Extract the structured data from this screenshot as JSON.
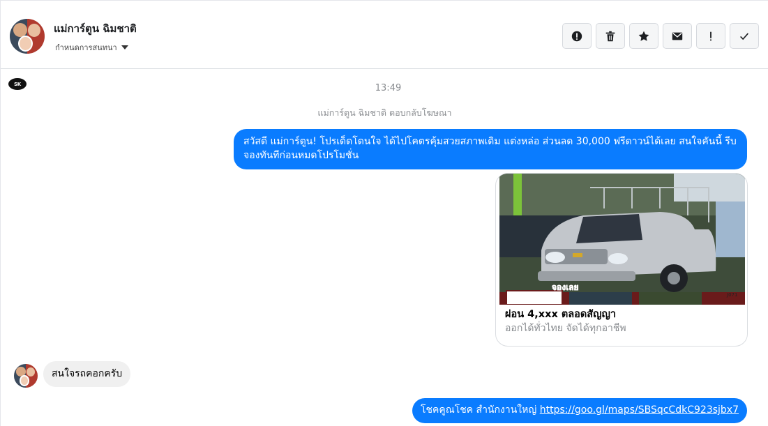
{
  "header": {
    "contact_name": "แม่การ์ตูน ฉิมชาติ",
    "status_label": "กำหนดการสนทนา",
    "toolbar": [
      {
        "name": "report-button",
        "icon": "exclamation-circle-icon"
      },
      {
        "name": "delete-button",
        "icon": "trash-icon"
      },
      {
        "name": "star-button",
        "icon": "star-icon"
      },
      {
        "name": "mark-unread-button",
        "icon": "envelope-icon"
      },
      {
        "name": "priority-button",
        "icon": "exclamation-icon"
      },
      {
        "name": "done-button",
        "icon": "check-icon"
      }
    ]
  },
  "thread": {
    "page_logo": "SK",
    "timestamp": "13:49",
    "notice": "แม่การ์ตูน ฉิมชาติ ตอบกลับโฆษณา",
    "outgoing_1": "สวัสดี แม่การ์ตูน! โปรเด็ดโดนใจ ได้ไปโคตรคุ้มสวยสภาพเดิม แต่งหล่อ  ส่วนลด 30,000 ฟรีดาวน์ได้เลย  สนใจคันนี้ รีบจองทันทีก่อนหมดโปรโมชั่น",
    "card": {
      "badge": "จองเลย",
      "plate": "J071",
      "title": "ผ่อน 4,xxx ตลอดสัญญา",
      "subtitle": "ออกได้ทั่วไทย จัดได้ทุกอาชีพ"
    },
    "incoming_1": "สนใจรถคอกครับ",
    "outgoing_2_text": "โชคคูณโชค สำนักงานใหญ่ ",
    "outgoing_2_link": "https://goo.gl/maps/SBSqcCdkC923sjbx7"
  },
  "colors": {
    "outgoing_bubble": "#0a7cff",
    "incoming_bubble": "#f0f0f0",
    "muted_text": "#8a8d91"
  }
}
